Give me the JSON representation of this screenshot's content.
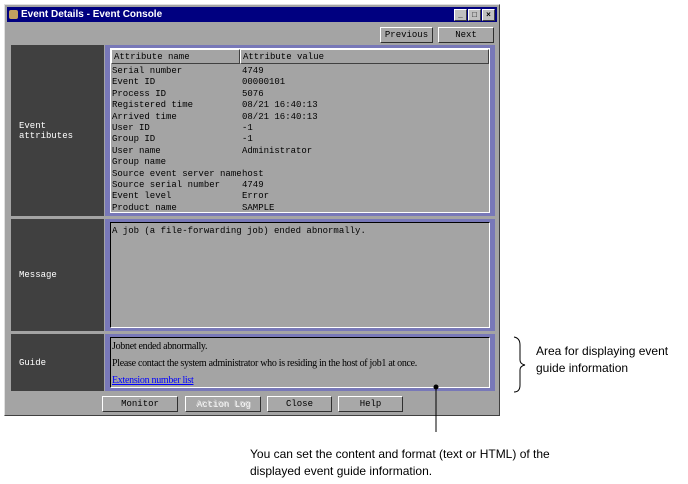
{
  "window": {
    "title": "Event Details - Event Console"
  },
  "nav": {
    "previous": "Previous",
    "next": "Next"
  },
  "attributes": {
    "label": "Event attributes",
    "columns": [
      "Attribute name",
      "Attribute value"
    ],
    "rows": [
      [
        "Serial number",
        "4749"
      ],
      [
        "Event ID",
        "00000101"
      ],
      [
        "Process ID",
        "5076"
      ],
      [
        "Registered time",
        "08/21 16:40:13"
      ],
      [
        "Arrived time",
        "08/21 16:40:13"
      ],
      [
        "User ID",
        "-1"
      ],
      [
        "Group ID",
        "-1"
      ],
      [
        "User name",
        "Administrator"
      ],
      [
        "Group name",
        ""
      ],
      [
        "Source event server name",
        "host"
      ],
      [
        "Source serial number",
        "4749"
      ],
      [
        "Event level",
        "Error"
      ],
      [
        "Product name",
        "SAMPLE"
      ]
    ]
  },
  "message": {
    "label": "Message",
    "text": "A job (a file-forwarding job) ended abnormally."
  },
  "guide": {
    "label": "Guide",
    "line1": "Jobnet ended abnormally.",
    "line2": "Please contact the system administrator who is residing in the host of job1 at once.",
    "link": "Extension number list"
  },
  "footer": {
    "monitor": "Monitor",
    "action_log": "Action Log",
    "close": "Close",
    "help": "Help"
  },
  "annotations": {
    "area": [
      "Area for displaying event",
      "guide information"
    ],
    "format": [
      "You can set the content and format (text or HTML) of the",
      "displayed event guide information."
    ]
  }
}
